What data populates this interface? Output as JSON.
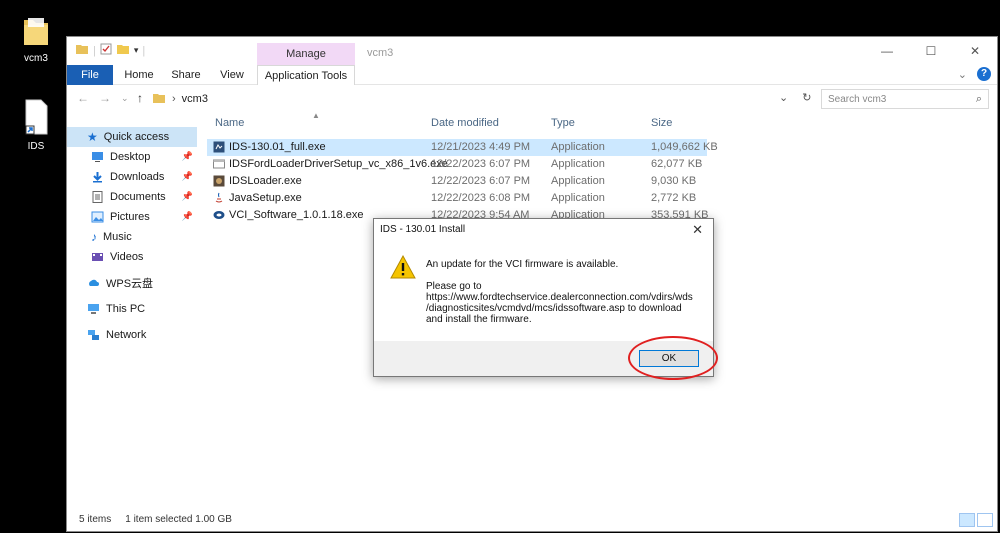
{
  "desktop": {
    "icons": [
      {
        "label": "vcm3",
        "icon": "folder-icon"
      },
      {
        "label": "IDS",
        "icon": "shortcut-icon"
      }
    ]
  },
  "window": {
    "title": "vcm3",
    "manage_tab": "Manage",
    "ribbon_tabs": [
      "File",
      "Home",
      "Share",
      "View",
      "Application Tools"
    ],
    "address_path": "vcm3",
    "search_placeholder": "Search vcm3"
  },
  "nav": {
    "items": [
      {
        "label": "Quick access",
        "icon": "star-icon"
      },
      {
        "label": "Desktop",
        "icon": "desktop-icon"
      },
      {
        "label": "Downloads",
        "icon": "download-icon"
      },
      {
        "label": "Documents",
        "icon": "document-icon"
      },
      {
        "label": "Pictures",
        "icon": "pictures-icon"
      },
      {
        "label": "Music",
        "icon": "music-icon"
      },
      {
        "label": "Videos",
        "icon": "video-icon"
      },
      {
        "label": "WPS云盘",
        "icon": "cloud-icon"
      },
      {
        "label": "This PC",
        "icon": "pc-icon"
      },
      {
        "label": "Network",
        "icon": "network-icon"
      }
    ]
  },
  "files": {
    "columns": [
      "Name",
      "Date modified",
      "Type",
      "Size"
    ],
    "rows": [
      {
        "name": "IDS-130.01_full.exe",
        "modified": "12/21/2023 4:49 PM",
        "type": "Application",
        "size": "1,049,662 KB"
      },
      {
        "name": "IDSFordLoaderDriverSetup_vc_x86_1v6.exe",
        "modified": "12/22/2023 6:07 PM",
        "type": "Application",
        "size": "62,077 KB"
      },
      {
        "name": "IDSLoader.exe",
        "modified": "12/22/2023 6:07 PM",
        "type": "Application",
        "size": "9,030 KB"
      },
      {
        "name": "JavaSetup.exe",
        "modified": "12/22/2023 6:08 PM",
        "type": "Application",
        "size": "2,772 KB"
      },
      {
        "name": "VCI_Software_1.0.1.18.exe",
        "modified": "12/22/2023 9:54 AM",
        "type": "Application",
        "size": "353,591 KB"
      }
    ]
  },
  "status": {
    "count": "5 items",
    "selection": "1 item selected  1.00 GB"
  },
  "dialog": {
    "title": "IDS - 130.01 Install",
    "message": "An update for the VCI firmware is available.",
    "detail_lines": [
      "Please go to",
      "https://www.fordtechservice.dealerconnection.com/vdirs/wds",
      "/diagnosticsites/vcmdvd/mcs/idssoftware.asp to download",
      "and install the firmware."
    ],
    "ok_label": "OK"
  }
}
